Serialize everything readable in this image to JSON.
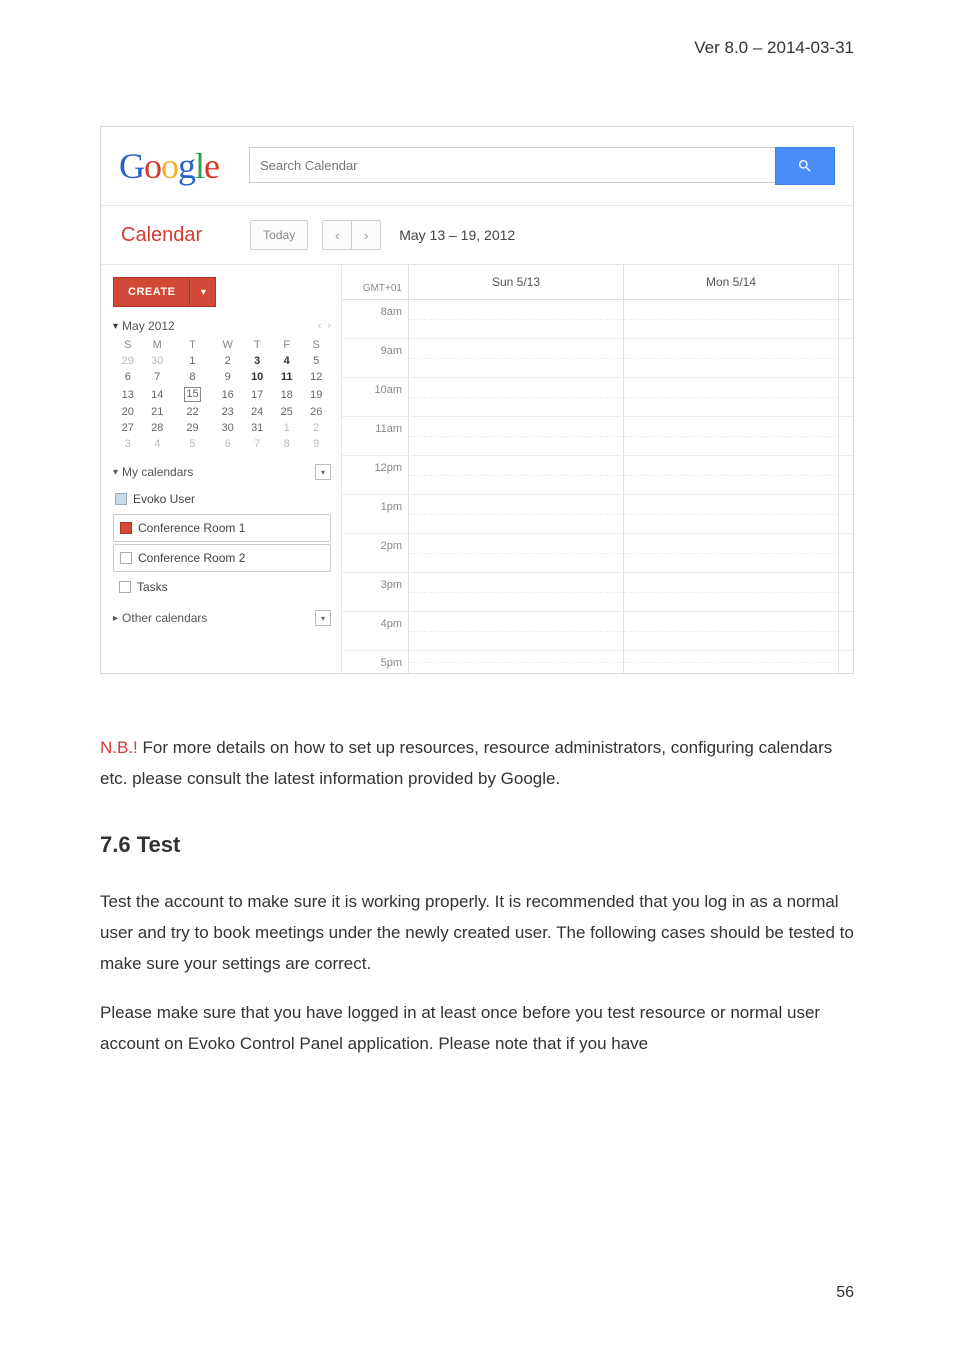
{
  "doc": {
    "version": "Ver 8.0 – 2014-03-31",
    "nb_label": "N.B.!",
    "para1": " For more details on how to set up resources, resource administrators, configuring calendars etc. please consult the latest information provided by Google.",
    "section_heading": "7.6 Test",
    "para2": "Test the account to make sure it is working properly. It is recommended that you log in as a normal user and try to book meetings under the newly created user. The following cases should be tested to make sure your settings are correct.",
    "para3": "Please make sure that you have logged in at least once before you test resource or normal user account on Evoko Control Panel application. Please note that if you have",
    "page_number": "56"
  },
  "app": {
    "logo_chars": [
      "G",
      "o",
      "o",
      "g",
      "l",
      "e"
    ],
    "search_placeholder": "Search Calendar",
    "calendar_label": "Calendar",
    "today_label": "Today",
    "prev_arrow": "‹",
    "next_arrow": "›",
    "date_range": "May 13 – 19, 2012",
    "create_label": "CREATE",
    "create_caret": "▾",
    "tz_label": "GMT+01",
    "day_headers": [
      "Sun 5/13",
      "Mon 5/14"
    ],
    "time_rows": [
      "8am",
      "9am",
      "10am",
      "11am",
      "12pm",
      "1pm",
      "2pm",
      "3pm",
      "4pm",
      "5pm"
    ],
    "mini": {
      "title": "May 2012",
      "caret": "▾",
      "nav_prev": "‹",
      "nav_next": "›",
      "dow": [
        "S",
        "M",
        "T",
        "W",
        "T",
        "F",
        "S"
      ]
    },
    "my_cal": {
      "label": "My calendars",
      "caret": "▾",
      "menu": "▾",
      "items": [
        "Evoko User",
        "Conference Room 1",
        "Conference Room 2",
        "Tasks"
      ]
    },
    "other_cal": {
      "label": "Other calendars",
      "caret": "▸",
      "menu": "▾"
    }
  },
  "chart_data": {
    "type": "table",
    "title": "Mini calendar May 2012",
    "headers": [
      "S",
      "M",
      "T",
      "W",
      "T",
      "F",
      "S"
    ],
    "rows": [
      [
        29,
        30,
        1,
        2,
        3,
        4,
        5
      ],
      [
        6,
        7,
        8,
        9,
        10,
        11,
        12
      ],
      [
        13,
        14,
        15,
        16,
        17,
        18,
        19
      ],
      [
        20,
        21,
        22,
        23,
        24,
        25,
        26
      ],
      [
        27,
        28,
        29,
        30,
        31,
        1,
        2
      ],
      [
        3,
        4,
        5,
        6,
        7,
        8,
        9
      ]
    ],
    "leading_dim": [
      29,
      30
    ],
    "trailing_dim_row5": [
      1,
      2
    ],
    "trailing_dim_row6": [
      3,
      4,
      5,
      6,
      7,
      8,
      9
    ],
    "bold_days": [
      3,
      4,
      10,
      11
    ],
    "selected_day": 15
  }
}
